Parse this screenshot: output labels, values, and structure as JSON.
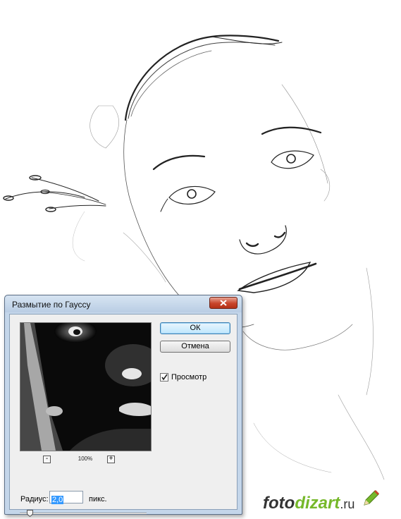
{
  "dialog": {
    "title": "Размытие по Гауссу",
    "ok_label": "ОК",
    "cancel_label": "Отмена",
    "preview_label": "Просмотр",
    "preview_checked": true,
    "zoom_out": "-",
    "zoom_in": "+",
    "zoom_level": "100%",
    "radius_label": "Радиус:",
    "radius_value": "2,0",
    "radius_unit": "пикс.",
    "slider_value_fraction": 0.08
  },
  "logo": {
    "part1": "foto",
    "part2": "dizart",
    "part3": ".ru"
  },
  "colors": {
    "titlebar": "#c4d6ea",
    "close_button": "#c8442a",
    "selection": "#3399ff",
    "logo_green": "#76b82a"
  }
}
